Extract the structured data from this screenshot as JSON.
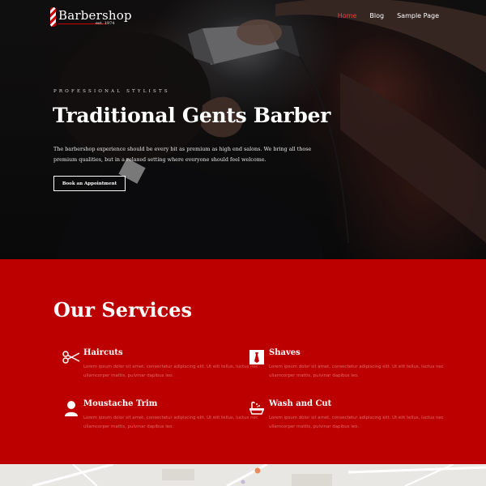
{
  "brand": {
    "name": "Barbershop",
    "est": "est. 1974"
  },
  "nav": {
    "items": [
      "Home",
      "Blog",
      "Sample Page"
    ],
    "active": "Home"
  },
  "hero": {
    "kicker": "PROFESSIONAL STYLISTS",
    "title": "Traditional Gents Barber",
    "description": "The barbershop experience should be every bit as premium as high end salons. We bring all those premium qualities, but in a relaxed setting where everyone should feel welcome.",
    "cta": "Book an Appointment"
  },
  "services": {
    "title": "Our Services",
    "items": [
      {
        "name": "Haircuts",
        "icon": "scissors-icon",
        "text": "Lorem ipsum dolor sit amet, consectetur adipiscing elit. Ut elit tellus, luctus nec ullamcorper mattis, pulvinar dapibus leo."
      },
      {
        "name": "Shaves",
        "icon": "tie-icon",
        "text": "Lorem ipsum dolor sit amet, consectetur adipiscing elit. Ut elit tellus, luctus nec ullamcorper mattis, pulvinar dapibus leo."
      },
      {
        "name": "Moustache Trim",
        "icon": "user-icon",
        "text": "Lorem ipsum dolor sit amet, consectetur adipiscing elit. Ut elit tellus, luctus nec ullamcorper mattis, pulvinar dapibus leo."
      },
      {
        "name": "Wash and Cut",
        "icon": "bathtub-icon",
        "text": "Lorem ipsum dolor sit amet, consectetur adipiscing elit. Ut elit tellus, luctus nec ullamcorper mattis, pulvinar dapibus leo."
      }
    ]
  },
  "colors": {
    "accent": "#bc0000",
    "nav_active": "#e8403a"
  }
}
